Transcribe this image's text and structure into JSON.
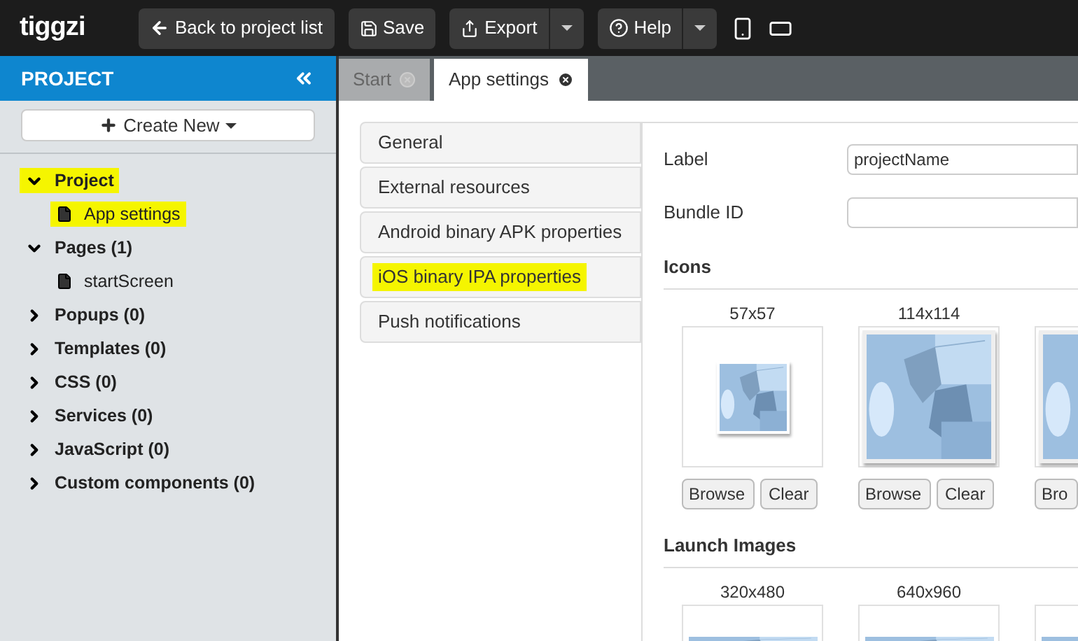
{
  "app": {
    "logo": "tiggzi"
  },
  "toolbar": [
    {
      "label": "Back to project list",
      "kind": "back",
      "dropdown": false
    },
    {
      "label": "Save",
      "kind": "save",
      "dropdown": false
    },
    {
      "label": "Export",
      "kind": "export",
      "dropdown": true
    },
    {
      "label": "Help",
      "kind": "help",
      "dropdown": true
    }
  ],
  "sidebar": {
    "title": "PROJECT",
    "create_button": "Create New",
    "tree": [
      {
        "label": "Project",
        "kind": "folder",
        "expanded": true,
        "highlighted": true,
        "children": [
          {
            "label": "App settings",
            "kind": "file",
            "highlighted": true
          }
        ]
      },
      {
        "label": "Pages (1)",
        "kind": "folder",
        "expanded": true,
        "highlighted": false,
        "children": [
          {
            "label": "startScreen",
            "kind": "file",
            "highlighted": false
          }
        ]
      },
      {
        "label": "Popups (0)",
        "kind": "folder",
        "expanded": false,
        "highlighted": false
      },
      {
        "label": "Templates (0)",
        "kind": "folder",
        "expanded": false,
        "highlighted": false
      },
      {
        "label": "CSS (0)",
        "kind": "folder",
        "expanded": false,
        "highlighted": false
      },
      {
        "label": "Services (0)",
        "kind": "folder",
        "expanded": false,
        "highlighted": false
      },
      {
        "label": "JavaScript (0)",
        "kind": "folder",
        "expanded": false,
        "highlighted": false
      },
      {
        "label": "Custom components (0)",
        "kind": "folder",
        "expanded": false,
        "highlighted": false
      }
    ]
  },
  "tabs": [
    {
      "label": "Start",
      "selected": false
    },
    {
      "label": "App settings",
      "selected": true
    }
  ],
  "settings_nav": [
    {
      "label": "General",
      "highlighted": false
    },
    {
      "label": "External resources",
      "highlighted": false
    },
    {
      "label": "Android binary APK properties",
      "highlighted": false
    },
    {
      "label": "iOS binary IPA properties",
      "highlighted": true
    },
    {
      "label": "Push notifications",
      "highlighted": false
    }
  ],
  "fields": [
    {
      "label": "Label",
      "value": "projectName"
    },
    {
      "label": "Bundle ID"
    }
  ],
  "sections": [
    {
      "title": "Icons",
      "tiles": [
        {
          "size": "57x57",
          "kind": "small",
          "browse": "Browse",
          "clear": "Clear"
        },
        {
          "size": "114x114",
          "kind": "large",
          "browse": "Browse",
          "clear": "Clear"
        },
        {
          "kind": "large",
          "browse": "Bro"
        }
      ]
    },
    {
      "title": "Launch Images",
      "tiles": [
        {
          "size": "320x480",
          "kind": "tall"
        },
        {
          "size": "640x960",
          "kind": "tall"
        },
        {
          "kind": "tall"
        }
      ]
    }
  ]
}
